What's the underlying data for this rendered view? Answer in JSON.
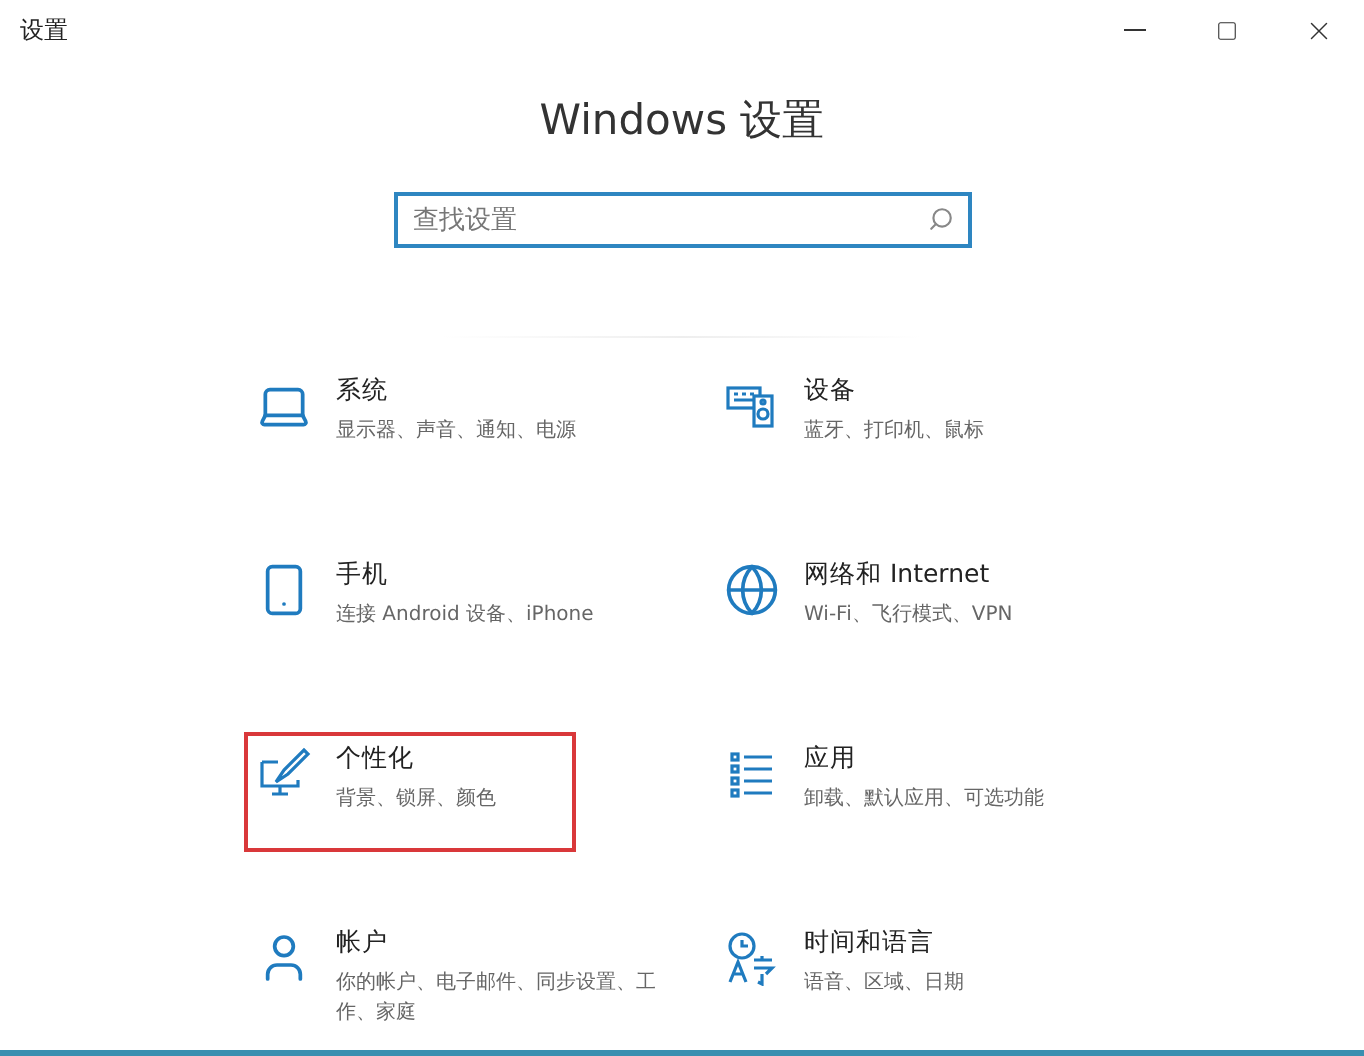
{
  "window": {
    "title": "设置"
  },
  "heading": "Windows 设置",
  "search": {
    "placeholder": "查找设置"
  },
  "categories": [
    {
      "title": "系统",
      "description": "显示器、声音、通知、电源",
      "highlighted": false
    },
    {
      "title": "设备",
      "description": "蓝牙、打印机、鼠标",
      "highlighted": false
    },
    {
      "title": "手机",
      "description": "连接 Android 设备、iPhone",
      "highlighted": false
    },
    {
      "title": "网络和 Internet",
      "description": "Wi-Fi、飞行模式、VPN",
      "highlighted": false
    },
    {
      "title": "个性化",
      "description": "背景、锁屏、颜色",
      "highlighted": true
    },
    {
      "title": "应用",
      "description": "卸载、默认应用、可选功能",
      "highlighted": false
    },
    {
      "title": "帐户",
      "description": "你的帐户、电子邮件、同步设置、工作、家庭",
      "highlighted": false
    },
    {
      "title": "时间和语言",
      "description": "语音、区域、日期",
      "highlighted": false
    }
  ]
}
